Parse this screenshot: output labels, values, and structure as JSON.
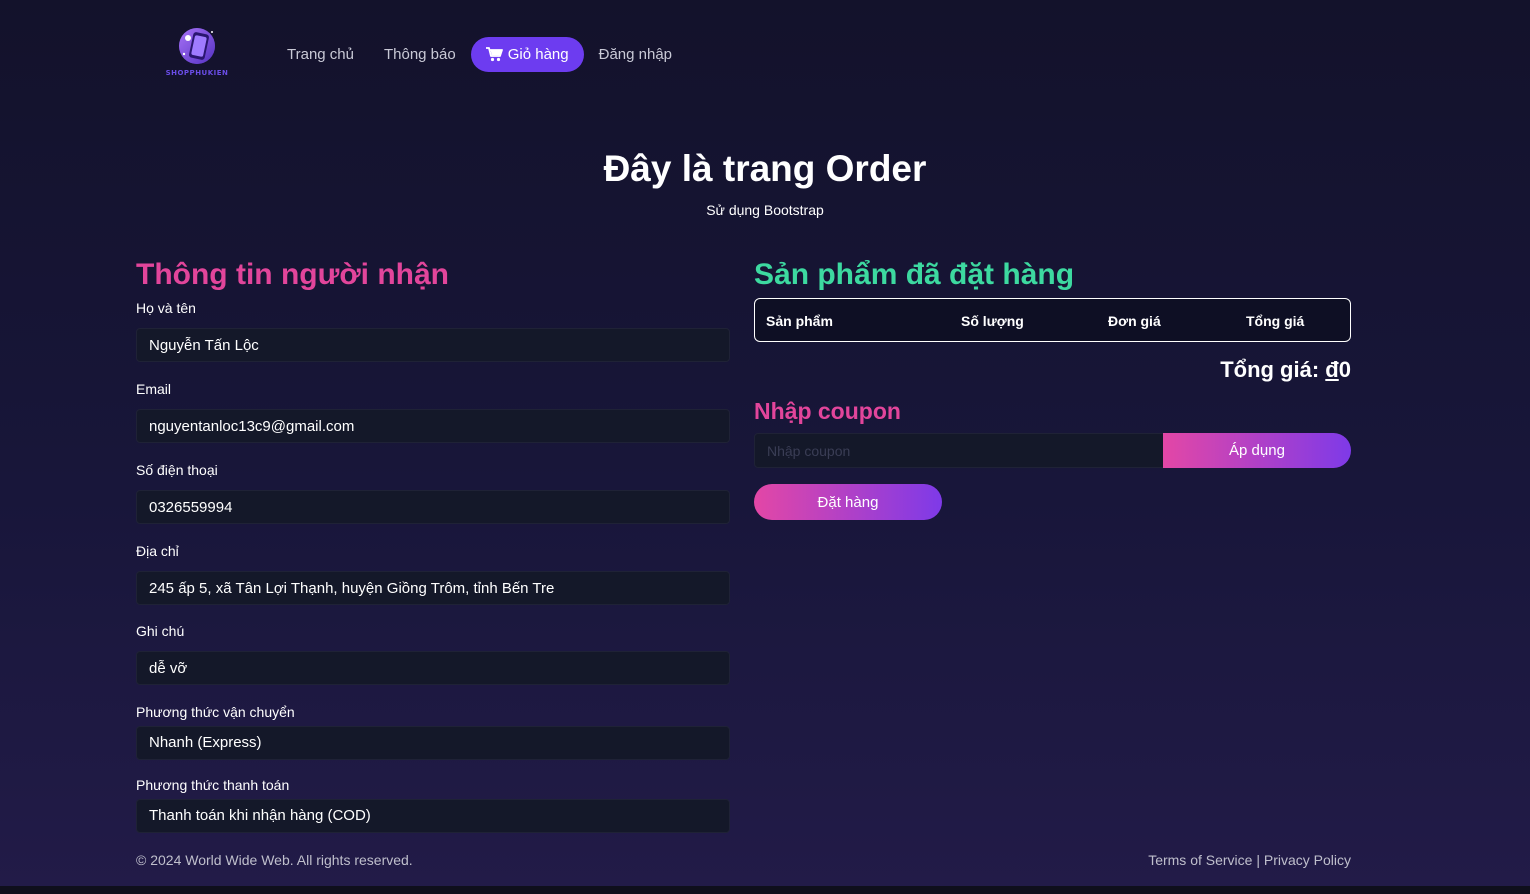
{
  "logo": {
    "text": "SHOPPHUKIEN",
    "icon": "phone-case-logo-icon"
  },
  "nav": {
    "items": [
      {
        "label": "Trang chủ"
      },
      {
        "label": "Thông báo"
      },
      {
        "label": "Giỏ hàng",
        "icon": "cart-icon",
        "active": true
      },
      {
        "label": "Đăng nhập"
      }
    ]
  },
  "hero": {
    "title": "Đây là trang Order",
    "subtitle": "Sử dụng Bootstrap"
  },
  "recipient": {
    "title": "Thông tin người nhận",
    "fields": [
      {
        "label": "Họ và tên",
        "value": "Nguyễn Tấn Lộc"
      },
      {
        "label": "Email",
        "value": "nguyentanloc13c9@gmail.com"
      },
      {
        "label": "Số điện thoại",
        "value": "0326559994"
      },
      {
        "label": "Địa chỉ",
        "value": "245 ấp 5, xã Tân Lợi Thạnh, huyện Giồng Trôm, tỉnh Bến Tre"
      },
      {
        "label": "Ghi chú",
        "value": "dễ vỡ"
      },
      {
        "label": "Phương thức vận chuyển",
        "value": "Nhanh (Express)"
      },
      {
        "label": "Phương thức thanh toán",
        "value": "Thanh toán khi nhận hàng (COD)"
      }
    ]
  },
  "order": {
    "title": "Sản phẩm đã đặt hàng",
    "columns": [
      "Sản phẩm",
      "Số lượng",
      "Đơn giá",
      "Tổng giá"
    ],
    "rows": [],
    "total_label": "Tổng giá:",
    "total_currency": "đ",
    "total_value": "0"
  },
  "coupon": {
    "title": "Nhập coupon",
    "placeholder": "Nhập coupon",
    "apply_label": "Áp dụng"
  },
  "place_order_label": "Đặt hàng",
  "footer": {
    "copyright": "© 2024 World Wide Web. All rights reserved.",
    "terms": "Terms of Service",
    "separator": "|",
    "privacy": "Privacy Policy"
  },
  "colors": {
    "background": "#16152f",
    "accent_pink": "#e2459b",
    "accent_green": "#3dd9a0",
    "accent_purple": "#6d3cf0"
  }
}
